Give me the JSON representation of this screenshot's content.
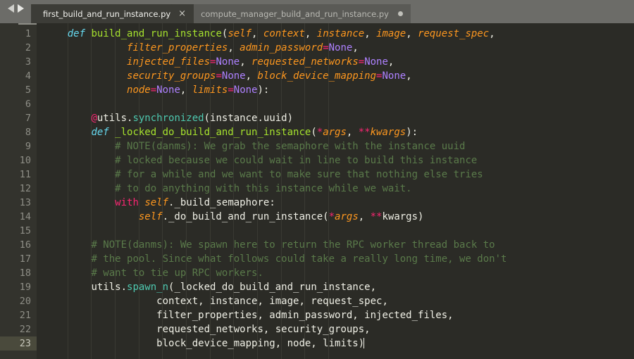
{
  "window": {
    "nav": {
      "back_icon": "arrow-left-icon",
      "forward_icon": "arrow-right-icon"
    }
  },
  "tabs": [
    {
      "label": "first_build_and_run_instance.py",
      "active": true,
      "close_glyph": "×",
      "modified": false
    },
    {
      "label": "compute_manager_build_and_run_instance.py",
      "active": false,
      "close_glyph": "",
      "modified": true
    }
  ],
  "editor": {
    "language": "python",
    "active_line": 23,
    "total_lines": 23,
    "colors": {
      "background": "#2b2b26",
      "gutter_background": "#33332d",
      "active_line_gutter": "#4a4a3c",
      "tabbar_background": "#6c6c68",
      "active_tab": "#3c3c37",
      "inactive_tab": "#5a5a56",
      "keyword": "#66d9ef",
      "control": "#f92672",
      "function": "#a6e22e",
      "call": "#4ec9b0",
      "parameter": "#fd971f",
      "constant": "#ae81ff",
      "comment": "#5a7a4a",
      "text": "#f0f0e6"
    },
    "line_numbers": [
      1,
      2,
      3,
      4,
      5,
      6,
      7,
      8,
      9,
      10,
      11,
      12,
      13,
      14,
      15,
      16,
      17,
      18,
      19,
      20,
      21,
      22,
      23
    ],
    "lines": [
      {
        "n": 1,
        "indent": 4,
        "tokens": [
          {
            "t": "def ",
            "c": "kw"
          },
          {
            "t": "build_and_run_instance",
            "c": "fn"
          },
          {
            "t": "(",
            "c": "plain"
          },
          {
            "t": "self",
            "c": "param"
          },
          {
            "t": ", ",
            "c": "plain"
          },
          {
            "t": "context",
            "c": "param"
          },
          {
            "t": ", ",
            "c": "plain"
          },
          {
            "t": "instance",
            "c": "param"
          },
          {
            "t": ", ",
            "c": "plain"
          },
          {
            "t": "image",
            "c": "param"
          },
          {
            "t": ", ",
            "c": "plain"
          },
          {
            "t": "request_spec",
            "c": "param"
          },
          {
            "t": ",",
            "c": "plain"
          }
        ]
      },
      {
        "n": 2,
        "indent": 14,
        "tokens": [
          {
            "t": "filter_properties",
            "c": "param"
          },
          {
            "t": ", ",
            "c": "plain"
          },
          {
            "t": "admin_password",
            "c": "param"
          },
          {
            "t": "=",
            "c": "ctrl"
          },
          {
            "t": "None",
            "c": "const"
          },
          {
            "t": ",",
            "c": "plain"
          }
        ]
      },
      {
        "n": 3,
        "indent": 14,
        "tokens": [
          {
            "t": "injected_files",
            "c": "param"
          },
          {
            "t": "=",
            "c": "ctrl"
          },
          {
            "t": "None",
            "c": "const"
          },
          {
            "t": ", ",
            "c": "plain"
          },
          {
            "t": "requested_networks",
            "c": "param"
          },
          {
            "t": "=",
            "c": "ctrl"
          },
          {
            "t": "None",
            "c": "const"
          },
          {
            "t": ",",
            "c": "plain"
          }
        ]
      },
      {
        "n": 4,
        "indent": 14,
        "tokens": [
          {
            "t": "security_groups",
            "c": "param"
          },
          {
            "t": "=",
            "c": "ctrl"
          },
          {
            "t": "None",
            "c": "const"
          },
          {
            "t": ", ",
            "c": "plain"
          },
          {
            "t": "block_device_mapping",
            "c": "param"
          },
          {
            "t": "=",
            "c": "ctrl"
          },
          {
            "t": "None",
            "c": "const"
          },
          {
            "t": ",",
            "c": "plain"
          }
        ]
      },
      {
        "n": 5,
        "indent": 14,
        "tokens": [
          {
            "t": "node",
            "c": "param"
          },
          {
            "t": "=",
            "c": "ctrl"
          },
          {
            "t": "None",
            "c": "const"
          },
          {
            "t": ", ",
            "c": "plain"
          },
          {
            "t": "limits",
            "c": "param"
          },
          {
            "t": "=",
            "c": "ctrl"
          },
          {
            "t": "None",
            "c": "const"
          },
          {
            "t": "):",
            "c": "plain"
          }
        ]
      },
      {
        "n": 6,
        "indent": 0,
        "tokens": []
      },
      {
        "n": 7,
        "indent": 8,
        "tokens": [
          {
            "t": "@",
            "c": "ctrl"
          },
          {
            "t": "utils.",
            "c": "plain"
          },
          {
            "t": "synchronized",
            "c": "call"
          },
          {
            "t": "(instance.uuid)",
            "c": "plain"
          }
        ]
      },
      {
        "n": 8,
        "indent": 8,
        "tokens": [
          {
            "t": "def ",
            "c": "kw"
          },
          {
            "t": "_locked_do_build_and_run_instance",
            "c": "fn"
          },
          {
            "t": "(",
            "c": "plain"
          },
          {
            "t": "*",
            "c": "ctrl"
          },
          {
            "t": "args",
            "c": "param"
          },
          {
            "t": ", ",
            "c": "plain"
          },
          {
            "t": "**",
            "c": "ctrl"
          },
          {
            "t": "kwargs",
            "c": "param"
          },
          {
            "t": "):",
            "c": "plain"
          }
        ]
      },
      {
        "n": 9,
        "indent": 12,
        "tokens": [
          {
            "t": "# NOTE(danms): We grab the semaphore with the instance uuid",
            "c": "comment"
          }
        ]
      },
      {
        "n": 10,
        "indent": 12,
        "tokens": [
          {
            "t": "# locked because we could wait in line to build this instance",
            "c": "comment"
          }
        ]
      },
      {
        "n": 11,
        "indent": 12,
        "tokens": [
          {
            "t": "# for a while and we want to make sure that nothing else tries",
            "c": "comment"
          }
        ]
      },
      {
        "n": 12,
        "indent": 12,
        "tokens": [
          {
            "t": "# to do anything with this instance while we wait.",
            "c": "comment"
          }
        ]
      },
      {
        "n": 13,
        "indent": 12,
        "tokens": [
          {
            "t": "with ",
            "c": "ctrl"
          },
          {
            "t": "self",
            "c": "param"
          },
          {
            "t": "._build_semaphore:",
            "c": "plain"
          }
        ]
      },
      {
        "n": 14,
        "indent": 16,
        "tokens": [
          {
            "t": "self",
            "c": "param"
          },
          {
            "t": "._do_build_and_run_instance(",
            "c": "plain"
          },
          {
            "t": "*",
            "c": "ctrl"
          },
          {
            "t": "args",
            "c": "param"
          },
          {
            "t": ", ",
            "c": "plain"
          },
          {
            "t": "**",
            "c": "ctrl"
          },
          {
            "t": "kwargs)",
            "c": "plain"
          }
        ]
      },
      {
        "n": 15,
        "indent": 0,
        "tokens": []
      },
      {
        "n": 16,
        "indent": 8,
        "tokens": [
          {
            "t": "# NOTE(danms): We spawn here to return the RPC worker thread back to",
            "c": "comment"
          }
        ]
      },
      {
        "n": 17,
        "indent": 8,
        "tokens": [
          {
            "t": "# the pool. Since what follows could take a really long time, we don't",
            "c": "comment"
          }
        ]
      },
      {
        "n": 18,
        "indent": 8,
        "tokens": [
          {
            "t": "# want to tie up RPC workers.",
            "c": "comment"
          }
        ]
      },
      {
        "n": 19,
        "indent": 8,
        "tokens": [
          {
            "t": "utils.",
            "c": "plain"
          },
          {
            "t": "spawn_n",
            "c": "call"
          },
          {
            "t": "(_locked_do_build_and_run_instance,",
            "c": "plain"
          }
        ]
      },
      {
        "n": 20,
        "indent": 19,
        "tokens": [
          {
            "t": "context, instance, image, request_spec,",
            "c": "plain"
          }
        ]
      },
      {
        "n": 21,
        "indent": 19,
        "tokens": [
          {
            "t": "filter_properties, admin_password, injected_files,",
            "c": "plain"
          }
        ]
      },
      {
        "n": 22,
        "indent": 19,
        "tokens": [
          {
            "t": "requested_networks, security_groups,",
            "c": "plain"
          }
        ]
      },
      {
        "n": 23,
        "indent": 19,
        "tokens": [
          {
            "t": "block_device_mapping, node, limits)",
            "c": "plain"
          }
        ],
        "cursor": true
      }
    ]
  }
}
